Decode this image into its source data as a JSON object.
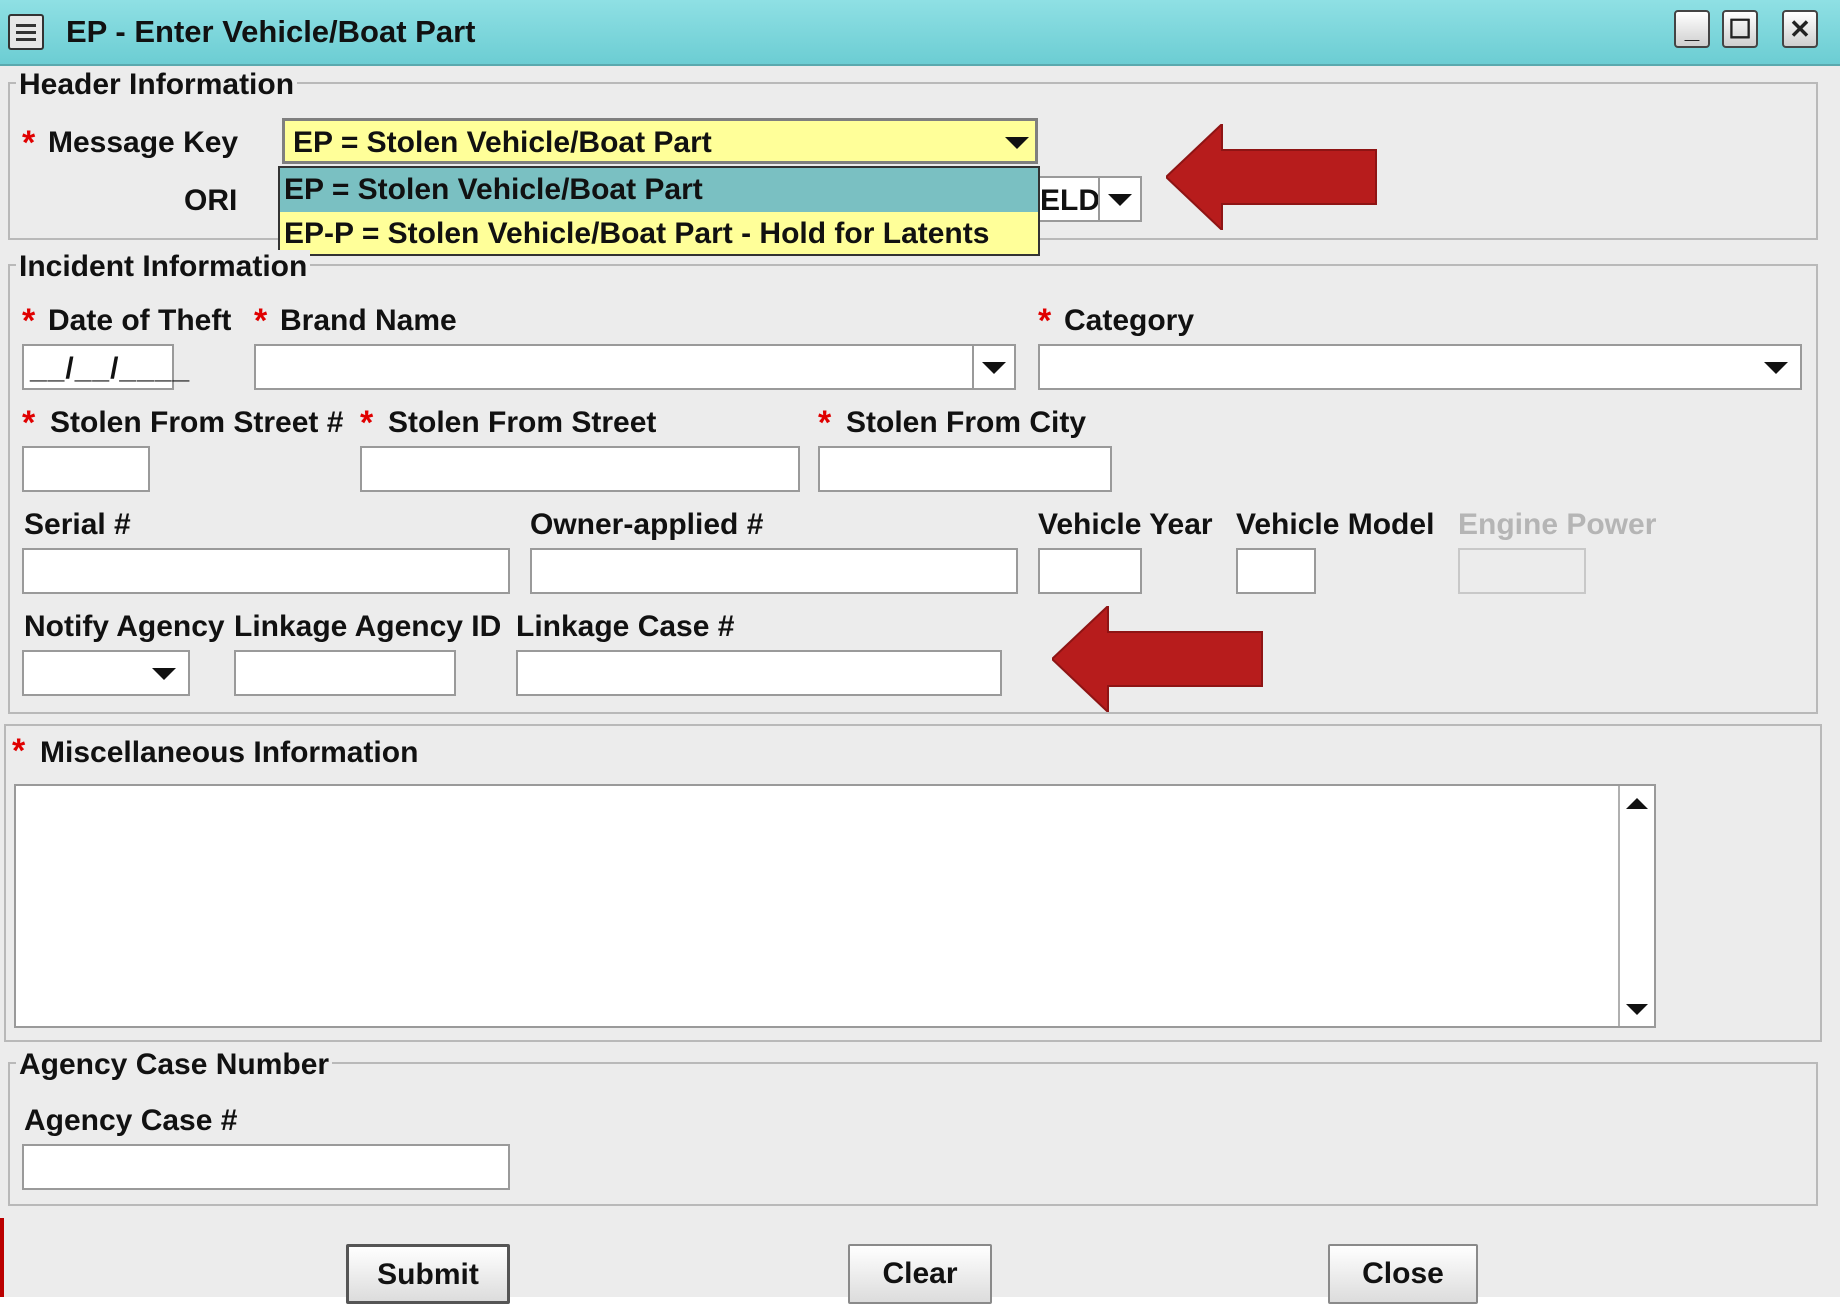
{
  "window": {
    "title": "EP - Enter Vehicle/Boat Part",
    "minimize": "_",
    "maximize": "☐",
    "close": "✕"
  },
  "header": {
    "legend": "Header Information",
    "message_key_label": "Message Key",
    "message_key_value": "EP = Stolen Vehicle/Boat Part",
    "ori_label": "ORI",
    "ori_value_partial": "ELD",
    "dropdown_options": [
      "EP = Stolen Vehicle/Boat Part",
      "EP-P = Stolen Vehicle/Boat Part - Hold for Latents"
    ]
  },
  "incident": {
    "legend": "Incident Information",
    "date_of_theft_label": "Date of Theft",
    "date_mask": "__/__/____",
    "brand_name_label": "Brand Name",
    "category_label": "Category",
    "street_no_label": "Stolen From Street #",
    "street_label": "Stolen From Street",
    "city_label": "Stolen From City",
    "serial_label": "Serial #",
    "owner_applied_label": "Owner-applied #",
    "vehicle_year_label": "Vehicle Year",
    "vehicle_model_label": "Vehicle Model",
    "engine_power_label": "Engine Power",
    "notify_agency_label": "Notify Agency",
    "linkage_agency_label": "Linkage Agency ID",
    "linkage_case_label": "Linkage Case #"
  },
  "misc": {
    "label": "Miscellaneous Information"
  },
  "agency_case": {
    "legend": "Agency Case Number",
    "label": "Agency Case #"
  },
  "buttons": {
    "submit": "Submit",
    "clear": "Clear",
    "close": "Close"
  },
  "required_marker": "*",
  "colors": {
    "titlebar": "#7dd6db",
    "highlight_field": "#ffff99",
    "dropdown_selected": "#7ac0c2",
    "required": "#e00000",
    "annotation_arrow": "#b71c1c"
  }
}
